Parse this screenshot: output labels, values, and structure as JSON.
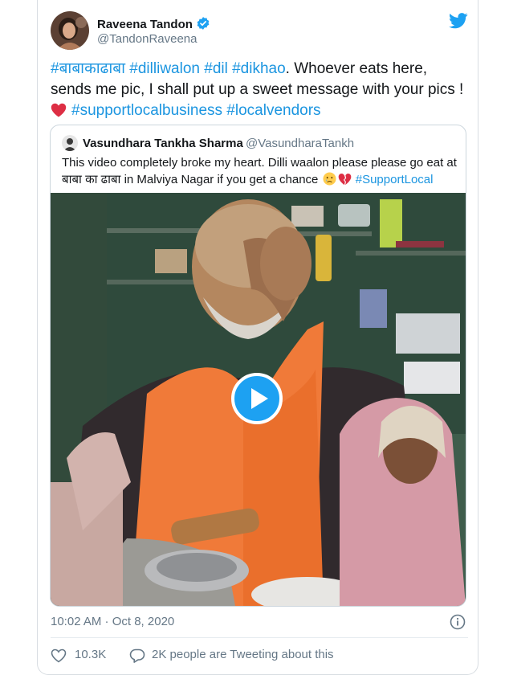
{
  "author": {
    "name": "Raveena Tandon",
    "handle": "@TandonRaveena"
  },
  "tweet": {
    "hashtag_1": "#बाबाकाढाबा",
    "hashtag_2": "#dilliwalon",
    "hashtag_3": "#dil",
    "hashtag_4": "#dikhao",
    "text_1": ". Whoever eats here, sends me pic, I shall put up a sweet message with your pics !",
    "hashtag_5": "#supportlocalbusiness",
    "hashtag_6": "#localvendors"
  },
  "quoted": {
    "name": "Vasundhara Tankha Sharma",
    "handle": "@VasundharaTankh",
    "text_1": "This video completely broke my heart. Dilli waalon please please go eat at बाबा का ढाबा in Malviya Nagar if you get a chance",
    "hashtag": "#SupportLocal"
  },
  "meta": {
    "timestamp": "10:02 AM · Oct 8, 2020"
  },
  "actions": {
    "like_count": "10.3K",
    "tweeting_about": "2K people are Tweeting about this"
  },
  "colors": {
    "link": "#1b95e0",
    "twitter_blue": "#1da1f2",
    "secondary": "#657786",
    "heart_red": "#e0245e"
  },
  "icons": [
    "verified-icon",
    "twitter-bird-icon",
    "heart-emoji",
    "crying-face-emoji",
    "broken-heart-emoji",
    "play-icon",
    "info-icon",
    "like-icon",
    "comment-icon"
  ]
}
